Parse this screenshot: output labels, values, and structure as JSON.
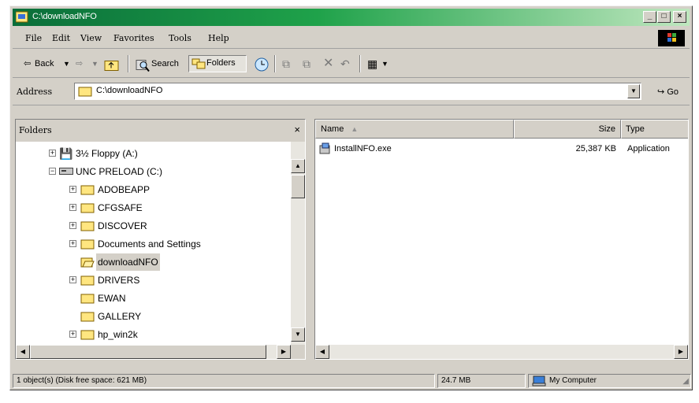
{
  "window": {
    "title": "C:\\downloadNFO"
  },
  "caption_buttons": {
    "minimize": "_",
    "maximize": "□",
    "close": "×"
  },
  "menu": [
    "File",
    "Edit",
    "View",
    "Favorites",
    "Tools",
    "Help"
  ],
  "toolbar": {
    "back": "Back",
    "search": "Search",
    "folders": "Folders"
  },
  "address": {
    "label": "Address",
    "value": "C:\\downloadNFO",
    "go": "Go"
  },
  "folders_pane": {
    "title": "Folders",
    "close": "×",
    "items": [
      {
        "label": "3½ Floppy (A:)",
        "expander": "+"
      },
      {
        "label": "UNC PRELOAD (C:)",
        "expander": "−"
      },
      {
        "label": "ADOBEAPP",
        "expander": "+"
      },
      {
        "label": "CFGSAFE",
        "expander": "+"
      },
      {
        "label": "DISCOVER",
        "expander": "+"
      },
      {
        "label": "Documents and Settings",
        "expander": "+"
      },
      {
        "label": "downloadNFO",
        "expander": ""
      },
      {
        "label": "DRIVERS",
        "expander": "+"
      },
      {
        "label": "EWAN",
        "expander": ""
      },
      {
        "label": "GALLERY",
        "expander": ""
      },
      {
        "label": "hp_win2k",
        "expander": "+"
      }
    ]
  },
  "file_list": {
    "columns": {
      "name": "Name",
      "size": "Size",
      "type": "Type"
    },
    "rows": [
      {
        "name": "InstallNFO.exe",
        "size": "25,387 KB",
        "type": "Application"
      }
    ]
  },
  "status": {
    "objects": "1 object(s) (Disk free space: 621 MB)",
    "size": "24.7 MB",
    "zone": "My Computer"
  }
}
